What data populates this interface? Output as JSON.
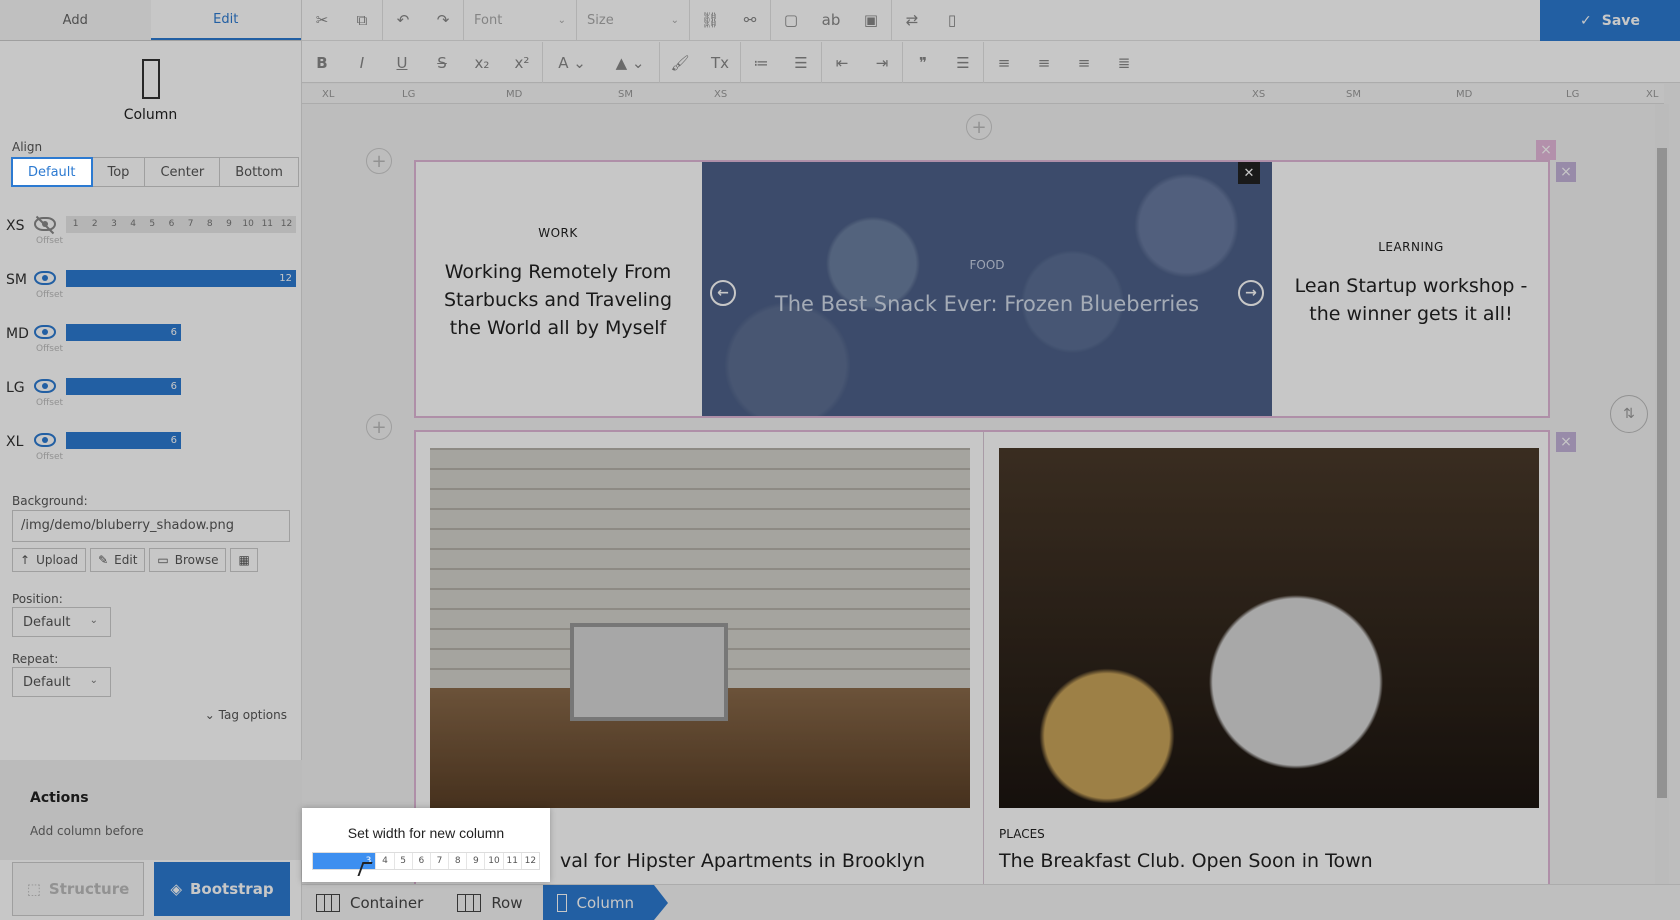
{
  "panel": {
    "tabs": [
      "Add",
      "Edit"
    ],
    "active_tab": "Edit",
    "component": "Column",
    "align": {
      "label": "Align",
      "options": [
        "Default",
        "Top",
        "Center",
        "Bottom"
      ],
      "selected": "Default"
    },
    "breakpoints": [
      {
        "name": "XS",
        "visible": false,
        "offset_label": "Offset",
        "grid": [
          "1",
          "2",
          "3",
          "4",
          "5",
          "6",
          "7",
          "8",
          "9",
          "10",
          "11",
          "12"
        ]
      },
      {
        "name": "SM",
        "visible": true,
        "offset_label": "Offset",
        "value": "12",
        "span": 12
      },
      {
        "name": "MD",
        "visible": true,
        "offset_label": "Offset",
        "value": "6",
        "span": 6
      },
      {
        "name": "LG",
        "visible": true,
        "offset_label": "Offset",
        "value": "6",
        "span": 6
      },
      {
        "name": "XL",
        "visible": true,
        "offset_label": "Offset",
        "value": "6",
        "span": 6
      }
    ],
    "background": {
      "label": "Background:",
      "value": "/img/demo/bluberry_shadow.png",
      "upload": "Upload",
      "edit": "Edit",
      "browse": "Browse"
    },
    "position": {
      "label": "Position:",
      "value": "Default"
    },
    "repeat": {
      "label": "Repeat:",
      "value": "Default"
    },
    "tag_options": "Tag options",
    "actions": {
      "title": "Actions",
      "add_before": "Add column before"
    },
    "modes": {
      "structure": "Structure",
      "bootstrap": "Bootstrap"
    }
  },
  "toolbar": {
    "font_placeholder": "Font",
    "size_placeholder": "Size",
    "save": "Save",
    "accent": "#2c7ad1"
  },
  "ruler": {
    "labels": [
      "XL",
      "LG",
      "MD",
      "SM",
      "XS",
      "XS",
      "SM",
      "MD",
      "LG",
      "XL"
    ]
  },
  "canvas": {
    "row1": {
      "left": {
        "category": "WORK",
        "title": "Working Remotely From Starbucks and Traveling the World all by Myself"
      },
      "carousel": {
        "category": "FOOD",
        "title": "The Best Snack Ever: Frozen Blueberries"
      },
      "right": {
        "category": "LEARNING",
        "title": "Lean Startup workshop - the winner gets it all!"
      }
    },
    "row2": {
      "col1": {
        "title_fragment": "val for Hipster Apartments in Brooklyn"
      },
      "col2": {
        "category": "PLACES",
        "title": "The Breakfast Club. Open Soon in Town"
      }
    }
  },
  "popup": {
    "title": "Set width for new column",
    "selected": "3",
    "grid": [
      "4",
      "5",
      "6",
      "7",
      "8",
      "9",
      "10",
      "11",
      "12"
    ]
  },
  "breadcrumb": [
    "Container",
    "Row",
    "Column"
  ],
  "active_crumb": "Column"
}
